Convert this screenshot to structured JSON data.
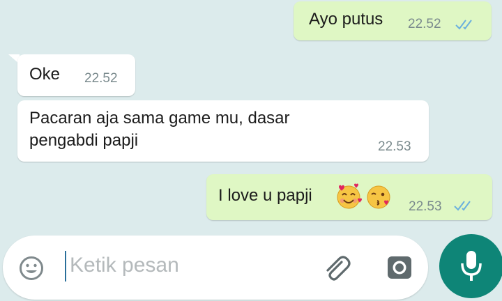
{
  "messages": [
    {
      "direction": "outgoing",
      "text": "Ayo putus",
      "time": "22.52",
      "status": "read"
    },
    {
      "direction": "incoming",
      "text": "Oke",
      "time": "22.52"
    },
    {
      "direction": "incoming",
      "text_lines": [
        "Pacaran aja sama game mu, dasar",
        "pengabdi papji"
      ],
      "time": "22.53"
    },
    {
      "direction": "outgoing",
      "text": "I love u papji",
      "emojis": [
        "smiling-face-with-hearts",
        "face-blowing-kiss"
      ],
      "time": "22.53",
      "status": "read"
    }
  ],
  "composer": {
    "placeholder": "Ketik pesan",
    "icons": [
      "emoji-icon",
      "attachment-icon",
      "camera-icon",
      "microphone-icon"
    ]
  },
  "colors": {
    "chat_background": "#dcebec",
    "outgoing_bubble": "#dff7c4",
    "incoming_bubble": "#ffffff",
    "read_ticks": "#6ab0de",
    "mic_button": "#0e8577"
  }
}
